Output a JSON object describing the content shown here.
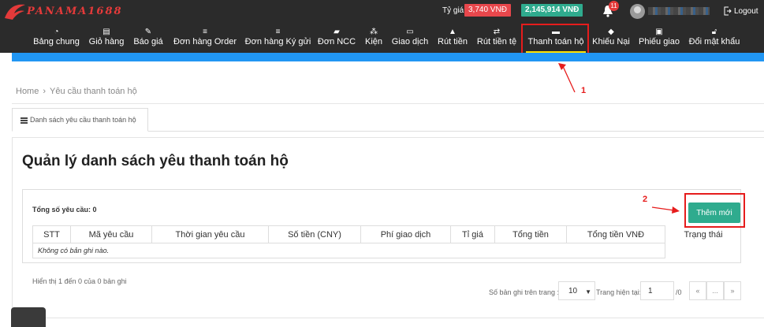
{
  "brand": {
    "name": "PANAMA1688"
  },
  "topbar": {
    "rate_label": "Tỷ giá:",
    "rate_value": "3,740 VNĐ",
    "balance": "2,145,914 VNĐ",
    "notification_count": "11",
    "logout": "Logout"
  },
  "nav": [
    {
      "label": "Bảng chung"
    },
    {
      "label": "Giỏ hàng"
    },
    {
      "label": "Báo giá"
    },
    {
      "label": "Đơn hàng Order"
    },
    {
      "label": "Đơn hàng Ký gửi"
    },
    {
      "label": "Đơn NCC"
    },
    {
      "label": "Kiện"
    },
    {
      "label": "Giao dịch"
    },
    {
      "label": "Rút tiền"
    },
    {
      "label": "Rút tiền tệ"
    },
    {
      "label": "Thanh toán hộ"
    },
    {
      "label": "Khiếu Nại"
    },
    {
      "label": "Phiếu giao"
    },
    {
      "label": "Đổi mật khẩu"
    }
  ],
  "annotations": {
    "one": "1",
    "two": "2"
  },
  "breadcrumb": {
    "home": "Home",
    "sep": "›",
    "current": "Yêu cầu thanh toán hộ"
  },
  "tab": {
    "label": "Danh sách yêu cầu thanh toán hộ"
  },
  "page": {
    "title": "Quản lý danh sách yêu thanh toán hộ"
  },
  "summary": {
    "label": "Tổng số yêu cầu:",
    "value": "0"
  },
  "actions": {
    "add": "Thêm mới"
  },
  "table": {
    "columns": [
      "STT",
      "Mã yêu cầu",
      "Thời gian yêu cầu",
      "Số tiền (CNY)",
      "Phí giao dịch",
      "Tỉ giá",
      "Tổng tiền",
      "Tổng tiền VNĐ",
      "Trạng thái"
    ],
    "empty": "Không có bản ghi nào."
  },
  "pagination": {
    "showing": "Hiển thị 1 đến 0 của 0 bản ghi",
    "per_page_label": "Số bản ghi trên trang :",
    "per_page": "10",
    "current_label": "Trang hiện tại:",
    "current": "1",
    "of": "/0",
    "first": "«",
    "dots": "...",
    "last": "»"
  }
}
